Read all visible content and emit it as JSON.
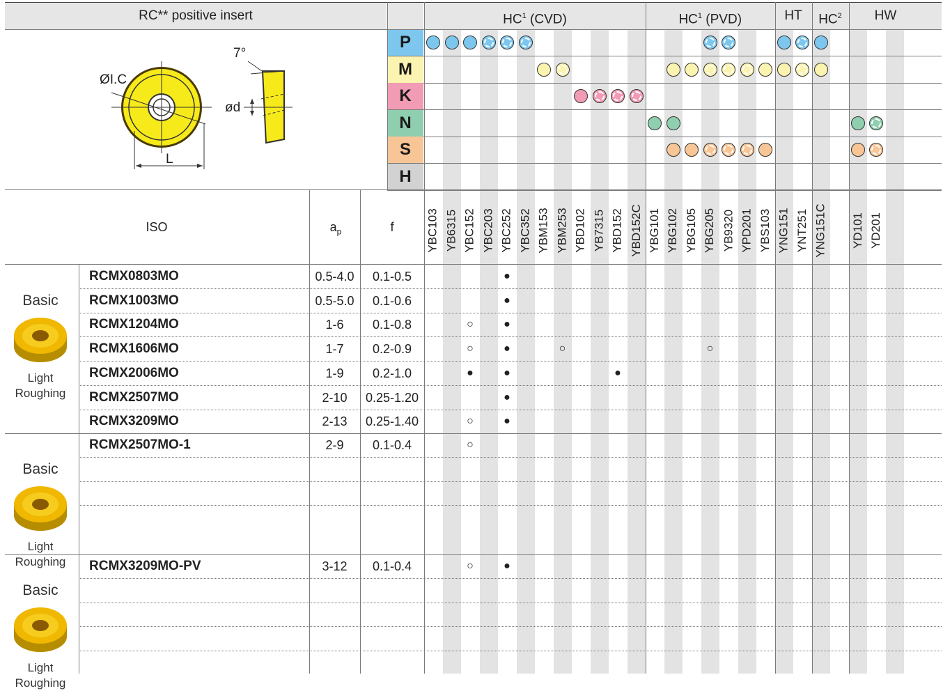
{
  "title": "RC** positive insert",
  "diagram": {
    "label_ic": "ØI.C",
    "label_angle": "7°",
    "label_d": "ød",
    "label_l": "L"
  },
  "families": [
    {
      "name": "HC",
      "sup": "1",
      "suffix": " (CVD)"
    },
    {
      "name": "HC",
      "sup": "1",
      "suffix": " (PVD)"
    },
    {
      "name": "HT",
      "sup": "",
      "suffix": ""
    },
    {
      "name": "HC",
      "sup": "2",
      "suffix": ""
    },
    {
      "name": "HW",
      "sup": "",
      "suffix": ""
    }
  ],
  "materials": [
    {
      "code": "P",
      "color": "#7dc7ef"
    },
    {
      "code": "M",
      "color": "#fbf3b0"
    },
    {
      "code": "K",
      "color": "#f29bb5"
    },
    {
      "code": "N",
      "color": "#8fceae"
    },
    {
      "code": "S",
      "color": "#f8c596"
    },
    {
      "code": "H",
      "color": "#d2d2d2"
    }
  ],
  "grades": [
    "YBC103",
    "YB6315",
    "YBC152",
    "YBC203",
    "YBC252",
    "YBC352",
    "YBM153",
    "YBM253",
    "YBD102",
    "YB7315",
    "YBD152",
    "YBD152C",
    "YBG101",
    "YBG102",
    "YBG105",
    "YBG205",
    "YB9320",
    "YPD201",
    "YBS103",
    "YNG151",
    "YNT251",
    "YNG151C",
    "",
    "YD101",
    "YD201",
    "",
    ""
  ],
  "suitability": {
    "P": [
      [
        0,
        "solid"
      ],
      [
        1,
        "solid"
      ],
      [
        2,
        "solid"
      ],
      [
        3,
        "spoke"
      ],
      [
        4,
        "spoke"
      ],
      [
        5,
        "burst"
      ],
      [
        15,
        "spoke"
      ],
      [
        16,
        "spoke"
      ],
      [
        19,
        "solid"
      ],
      [
        20,
        "spoke"
      ],
      [
        21,
        "solid"
      ]
    ],
    "M": [
      [
        6,
        "solid"
      ],
      [
        7,
        "spoke"
      ],
      [
        13,
        "solid"
      ],
      [
        14,
        "solid"
      ],
      [
        15,
        "spoke"
      ],
      [
        16,
        "spoke"
      ],
      [
        17,
        "spoke"
      ],
      [
        18,
        "solid"
      ],
      [
        19,
        "solid"
      ],
      [
        20,
        "spoke"
      ],
      [
        21,
        "solid"
      ]
    ],
    "K": [
      [
        8,
        "solid"
      ],
      [
        9,
        "spoke"
      ],
      [
        10,
        "spoke"
      ],
      [
        11,
        "spoke"
      ]
    ],
    "N": [
      [
        12,
        "solid"
      ],
      [
        13,
        "solid"
      ],
      [
        23,
        "solid"
      ],
      [
        24,
        "spoke"
      ]
    ],
    "S": [
      [
        13,
        "solid"
      ],
      [
        14,
        "solid"
      ],
      [
        15,
        "spoke"
      ],
      [
        16,
        "spoke"
      ],
      [
        17,
        "spoke"
      ],
      [
        18,
        "solid"
      ],
      [
        23,
        "solid"
      ],
      [
        24,
        "spoke"
      ]
    ],
    "H": []
  },
  "columns": {
    "iso": "ISO",
    "ap": "a",
    "ap_sub": "p",
    "f": "f"
  },
  "groups": [
    {
      "t1": "Basic",
      "t2a": "Light",
      "t2b": "Roughing"
    },
    {
      "t1": "Basic",
      "t2a": "Light",
      "t2b": "Roughing"
    },
    {
      "t1": "Basic",
      "t2a": "Light",
      "t2b": "Roughing"
    }
  ],
  "rows": [
    {
      "code": "RCMX0803MO",
      "ap": "0.5-4.0",
      "f": "0.1-0.5",
      "marks": [
        [
          4,
          "●"
        ]
      ]
    },
    {
      "code": "RCMX1003MO",
      "ap": "0.5-5.0",
      "f": "0.1-0.6",
      "marks": [
        [
          4,
          "●"
        ]
      ]
    },
    {
      "code": "RCMX1204MO",
      "ap": "1-6",
      "f": "0.1-0.8",
      "marks": [
        [
          2,
          "○"
        ],
        [
          4,
          "●"
        ]
      ]
    },
    {
      "code": "RCMX1606MO",
      "ap": "1-7",
      "f": "0.2-0.9",
      "marks": [
        [
          2,
          "○"
        ],
        [
          4,
          "●"
        ],
        [
          7,
          "○"
        ],
        [
          15,
          "○"
        ]
      ]
    },
    {
      "code": "RCMX2006MO",
      "ap": "1-9",
      "f": "0.2-1.0",
      "marks": [
        [
          2,
          "●"
        ],
        [
          4,
          "●"
        ],
        [
          10,
          "●"
        ]
      ]
    },
    {
      "code": "RCMX2507MO",
      "ap": "2-10",
      "f": "0.25-1.20",
      "marks": [
        [
          4,
          "●"
        ]
      ]
    },
    {
      "code": "RCMX3209MO",
      "ap": "2-13",
      "f": "0.25-1.40",
      "marks": [
        [
          2,
          "○"
        ],
        [
          4,
          "●"
        ]
      ]
    },
    {
      "code": "RCMX2507MO-1",
      "ap": "2-9",
      "f": "0.1-0.4",
      "marks": [
        [
          2,
          "○"
        ]
      ]
    },
    {
      "code": "",
      "ap": "",
      "f": "",
      "marks": []
    },
    {
      "code": "",
      "ap": "",
      "f": "",
      "marks": []
    },
    {
      "code": "",
      "ap": "",
      "f": "",
      "marks": []
    },
    {
      "code": "RCMX3209MO-PV",
      "ap": "3-12",
      "f": "0.1-0.4",
      "marks": [
        [
          2,
          "○"
        ],
        [
          4,
          "●"
        ]
      ]
    },
    {
      "code": "",
      "ap": "",
      "f": "",
      "marks": []
    },
    {
      "code": "",
      "ap": "",
      "f": "",
      "marks": []
    },
    {
      "code": "",
      "ap": "",
      "f": "",
      "marks": []
    },
    {
      "code": "",
      "ap": "",
      "f": "",
      "marks": []
    }
  ]
}
